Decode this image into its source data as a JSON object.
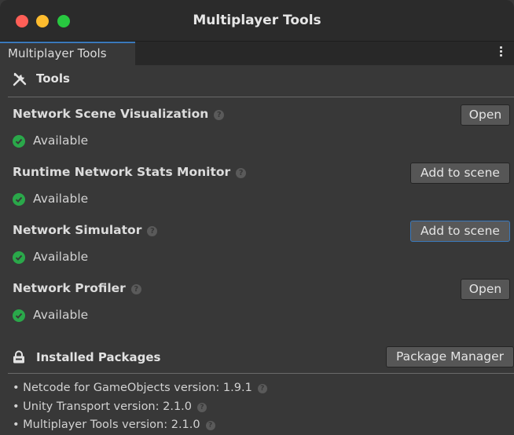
{
  "window": {
    "title": "Multiplayer Tools"
  },
  "tab": {
    "label": "Multiplayer Tools"
  },
  "tools_section": {
    "title": "Tools"
  },
  "tools": [
    {
      "name": "Network Scene Visualization",
      "status": "Available",
      "button": "Open"
    },
    {
      "name": "Runtime Network Stats Monitor",
      "status": "Available",
      "button": "Add to scene"
    },
    {
      "name": "Network Simulator",
      "status": "Available",
      "button": "Add to scene"
    },
    {
      "name": "Network Profiler",
      "status": "Available",
      "button": "Open"
    }
  ],
  "packages_section": {
    "title": "Installed Packages",
    "button": "Package Manager"
  },
  "packages": [
    "• Netcode for GameObjects version: 1.9.1",
    "• Unity Transport version: 2.1.0",
    "• Multiplayer Tools version: 2.1.0"
  ],
  "colors": {
    "accent": "#3a79bb",
    "available": "#2aa84a",
    "background": "#383838"
  }
}
